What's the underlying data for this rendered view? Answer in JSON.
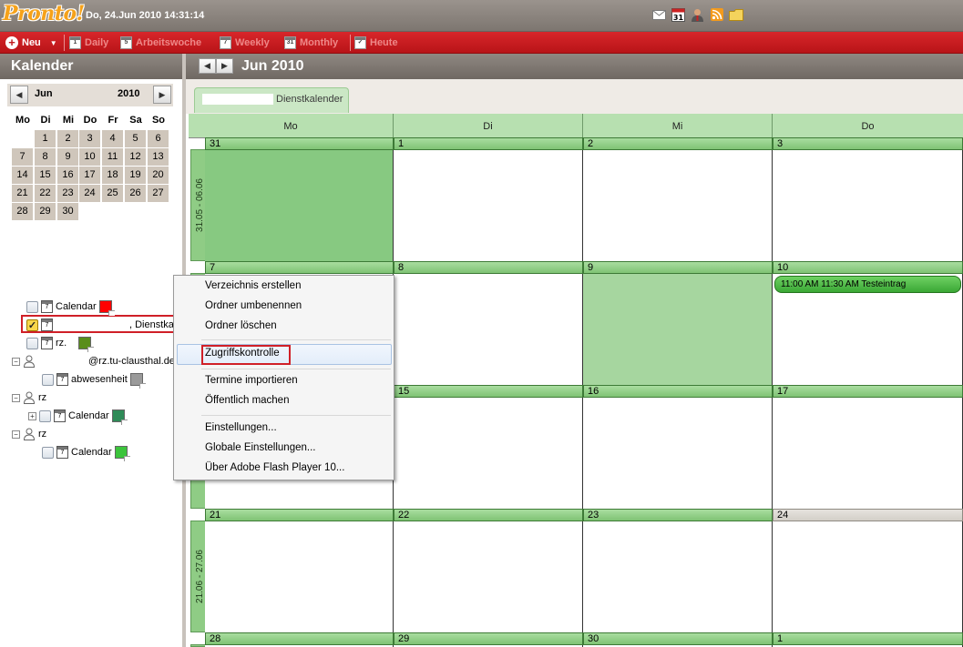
{
  "app": {
    "logo": "Pronto!",
    "datetime": "Do, 24.Jun 2010 14:31:14"
  },
  "top_icons": [
    "mail-icon",
    "calendar-31-icon",
    "contacts-icon",
    "rss-icon",
    "folder-icon"
  ],
  "toolbar": {
    "new_label": "Neu",
    "views": [
      {
        "label": "Daily",
        "icon": "1",
        "active": false
      },
      {
        "label": "Arbeitswoche",
        "icon": "5",
        "active": false
      },
      {
        "label": "Weekly",
        "icon": "7",
        "active": false
      },
      {
        "label": "Monthly",
        "icon": "31",
        "active": false
      },
      {
        "label": "Heute",
        "icon": "",
        "active": true
      }
    ]
  },
  "sidebar": {
    "title": "Kalender",
    "mini_calendar": {
      "month": "Jun",
      "year": "2010",
      "weekdays": [
        "Mo",
        "Di",
        "Mi",
        "Do",
        "Fr",
        "Sa",
        "So"
      ],
      "weeks": [
        [
          "",
          "1",
          "2",
          "3",
          "4",
          "5",
          "6"
        ],
        [
          "7",
          "8",
          "9",
          "10",
          "11",
          "12",
          "13"
        ],
        [
          "14",
          "15",
          "16",
          "17",
          "18",
          "19",
          "20"
        ],
        [
          "21",
          "22",
          "23",
          "24",
          "25",
          "26",
          "27"
        ],
        [
          "28",
          "29",
          "30",
          "",
          "",
          "",
          ""
        ]
      ]
    },
    "tree": [
      {
        "label": "Calendar",
        "color": "#ff0000"
      },
      {
        "label": ", Dienstkaler",
        "checked": true
      },
      {
        "label": "rz.",
        "color": "#5a8e1b"
      },
      {
        "label": "@rz.tu-clausthal.de"
      },
      {
        "label": "abwesenheit",
        "color": "#9a9a9a"
      },
      {
        "label": "rz"
      },
      {
        "label": "Calendar",
        "color": "#2e8b57"
      },
      {
        "label": "rz"
      },
      {
        "label": "Calendar",
        "color": "#3cc43c"
      }
    ]
  },
  "main": {
    "title": "Jun 2010",
    "tab_label": "Dienstkalender",
    "day_headers": [
      "Mo",
      "Di",
      "Mi",
      "Do"
    ],
    "weeks": [
      {
        "label": "31.05 - 06.06",
        "days": [
          "31",
          "1",
          "2",
          "3"
        ]
      },
      {
        "label": "",
        "days": [
          "7",
          "8",
          "9",
          "10"
        ]
      },
      {
        "label": "",
        "days": [
          "14",
          "15",
          "16",
          "17"
        ]
      },
      {
        "label": "21.06 - 27.06",
        "days": [
          "21",
          "22",
          "23",
          "24"
        ]
      },
      {
        "label": "",
        "days": [
          "28",
          "29",
          "30",
          "1"
        ]
      }
    ],
    "event": "11:00 AM 11:30 AM  Testeintrag"
  },
  "context_menu": {
    "items": [
      "Verzeichnis erstellen",
      "Ordner umbenennen",
      "Ordner löschen",
      "Zugriffskontrolle",
      "Termine importieren",
      "Öffentlich machen",
      "Einstellungen...",
      "Globale Einstellungen...",
      "Über Adobe Flash Player 10..."
    ]
  }
}
